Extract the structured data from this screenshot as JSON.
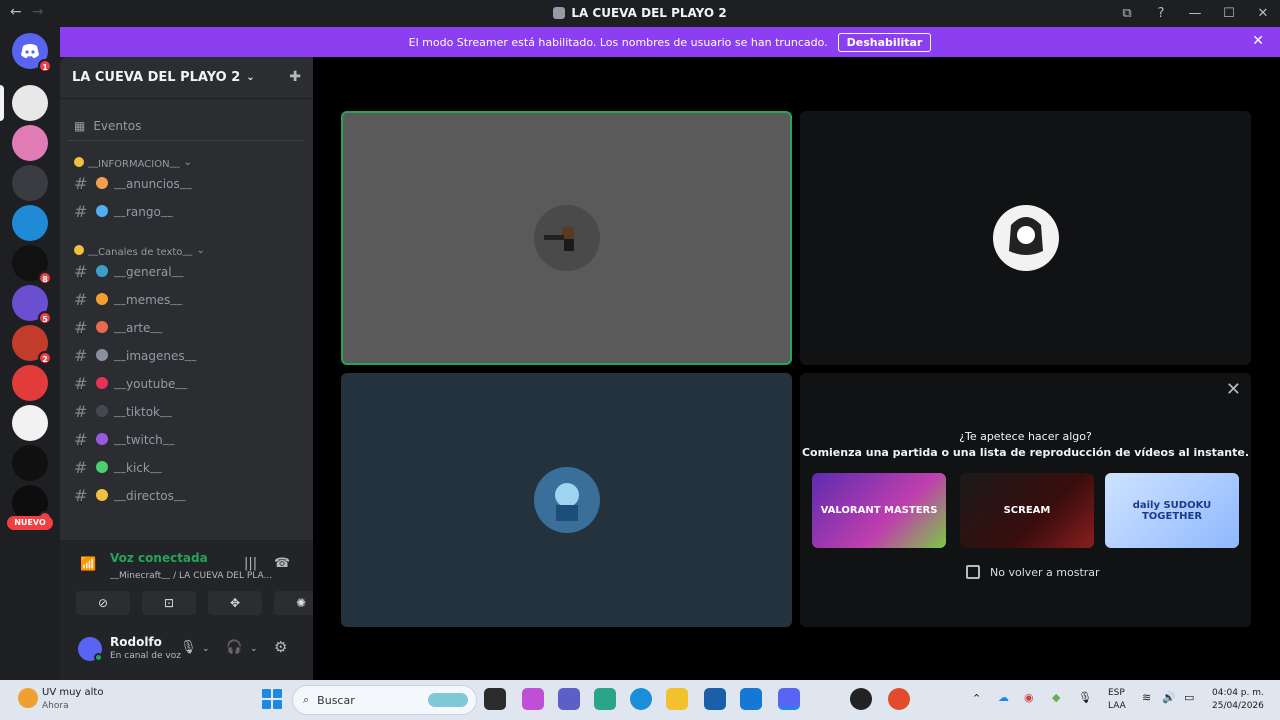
{
  "window": {
    "title": "LA CUEVA DEL PLAYO 2",
    "nav_back": "←",
    "nav_forward": "→",
    "controls": [
      "⧉",
      "?",
      "—",
      "☐",
      "✕"
    ]
  },
  "guilds": {
    "home_badge": "1",
    "items": [
      {
        "color": "#e8e8e8",
        "badge": ""
      },
      {
        "color": "#e07bb5",
        "badge": ""
      },
      {
        "color": "#3a3c42",
        "badge": ""
      },
      {
        "color": "#1f8ad6",
        "badge": ""
      },
      {
        "color": "#111111",
        "badge": "8"
      },
      {
        "color": "#6a4fd1",
        "badge": "5"
      },
      {
        "color": "#c33b2a",
        "badge": "2"
      },
      {
        "color": "#e23b3b",
        "badge": ""
      },
      {
        "color": "#f2f2f2",
        "badge": ""
      },
      {
        "color": "#101010",
        "badge": ""
      },
      {
        "color": "#0d0d0d",
        "badge": "4"
      }
    ],
    "new_label": "NUEVO"
  },
  "banner": {
    "text": "El modo Streamer está habilitado. Los nombres de usuario se han truncado.",
    "button": "Deshabilitar",
    "close": "✕"
  },
  "sidebar": {
    "server_name": "LA CUEVA DEL PLAYO 2",
    "events_label": "Eventos",
    "categories": [
      {
        "name": "﹏INFORMACION﹏",
        "channels": [
          {
            "name": "﹏anuncios﹏",
            "color": "#f0a050"
          },
          {
            "name": "﹏rango﹏",
            "color": "#4fb0f0"
          }
        ]
      },
      {
        "name": "﹏Canales de texto﹏",
        "channels": [
          {
            "name": "﹏general﹏",
            "color": "#3aa0c8"
          },
          {
            "name": "﹏memes﹏",
            "color": "#f0a030"
          },
          {
            "name": "﹏arte﹏",
            "color": "#e86a50"
          },
          {
            "name": "﹏imagenes﹏",
            "color": "#8a8fa0"
          },
          {
            "name": "﹏youtube﹏",
            "color": "#e8305a"
          },
          {
            "name": "﹏tiktok﹏",
            "color": "#444850"
          },
          {
            "name": "﹏twitch﹏",
            "color": "#9a5ae0"
          },
          {
            "name": "﹏kick﹏",
            "color": "#4ad070"
          },
          {
            "name": "﹏directos﹏",
            "color": "#f0c040"
          }
        ]
      }
    ]
  },
  "voice": {
    "title": "Voz conectada",
    "channel": "﹏Minecraft﹏ / LA CUEVA DEL PLA...",
    "buttons": [
      "⊘",
      "⊡",
      "✥",
      "✺"
    ]
  },
  "user": {
    "name": "Rodolfo",
    "status": "En canal de voz"
  },
  "stage": {
    "activity_question": "¿Te apetece hacer algo?",
    "activity_sub": "Comienza una partida o una lista de reproducción de vídeos al instante.",
    "activities": [
      "VALORANT MASTERS",
      "SCREAM",
      "daily SUDOKU TOGETHER"
    ],
    "dont_show": "No volver a mostrar",
    "close": "✕"
  },
  "taskbar": {
    "weather_title": "UV muy alto",
    "weather_sub": "Ahora",
    "search_placeholder": "Buscar",
    "lang1": "ESP",
    "lang2": "LAA",
    "time": "04:04 p. m.",
    "date": "25/04/2026"
  }
}
